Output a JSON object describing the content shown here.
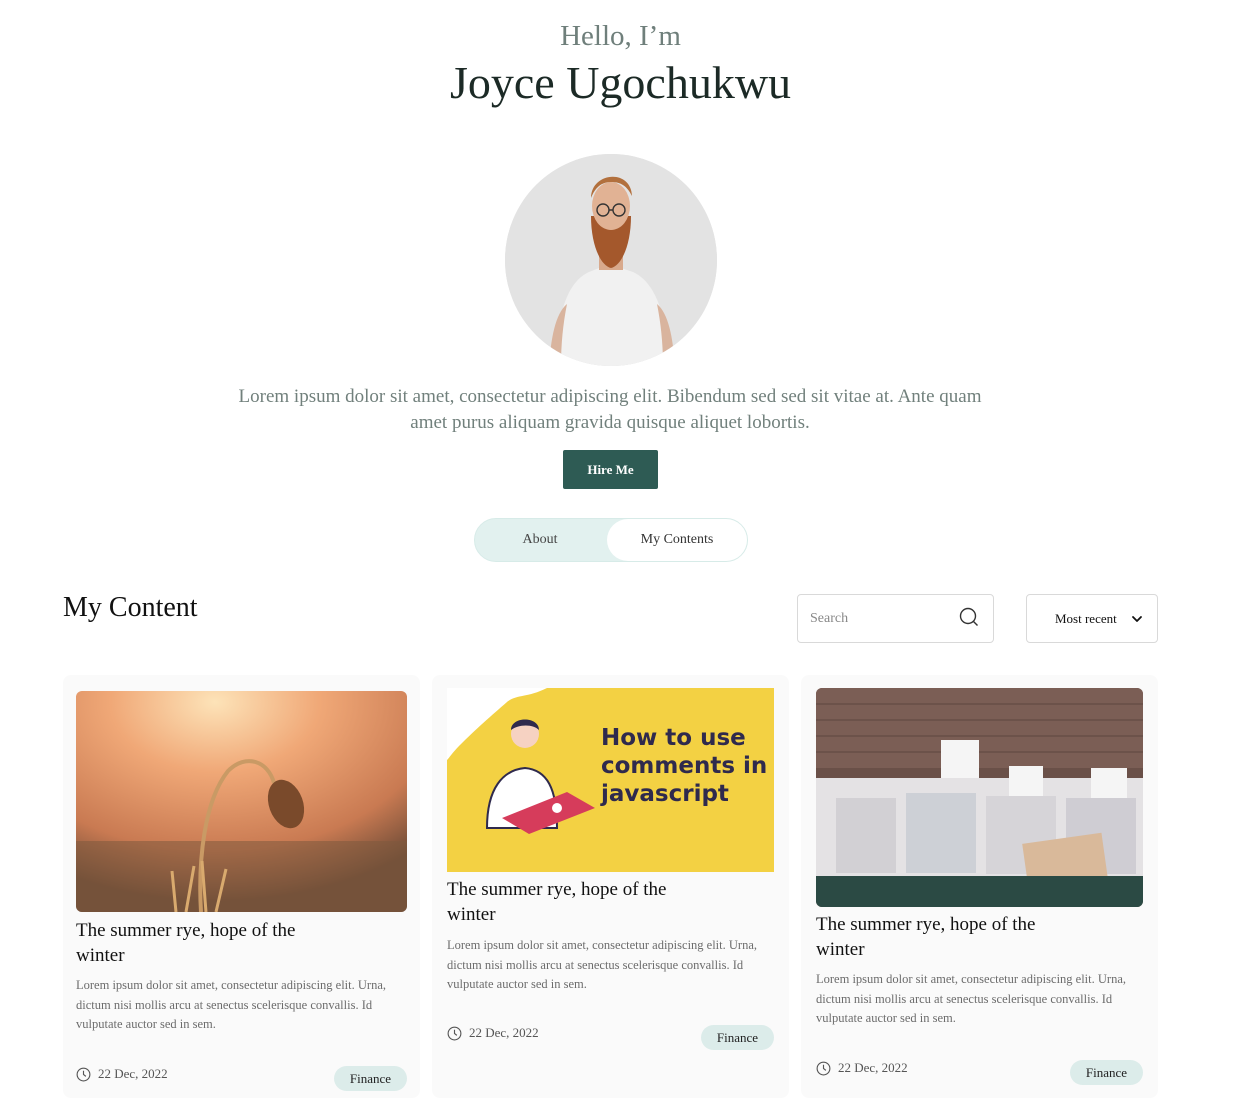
{
  "hero": {
    "greeting": "Hello, I’m",
    "name": "Joyce Ugochukwu",
    "bio": "Lorem ipsum dolor sit amet, consectetur adipiscing elit. Bibendum sed sed sit vitae at. Ante quam amet purus aliquam gravida quisque aliquet lobortis.",
    "hire_label": "Hire Me"
  },
  "tabs": [
    {
      "label": "About",
      "active": false
    },
    {
      "label": "My Contents",
      "active": true
    }
  ],
  "content": {
    "title": "My Content",
    "search_placeholder": "Search",
    "sort_value": "Most recent",
    "cards": [
      {
        "title": "The summer rye, hope of the winter",
        "text": "Lorem ipsum dolor sit amet, consectetur adipiscing elit. Urna, dictum nisi mollis arcu at senectus scelerisque convallis. Id vulputate auctor sed in sem.",
        "date": "22 Dec, 2022",
        "tag": "Finance"
      },
      {
        "title": "The summer rye, hope of the winter",
        "text": "Lorem ipsum dolor sit amet, consectetur adipiscing elit. Urna, dictum nisi mollis arcu at senectus scelerisque convallis. Id vulputate auctor sed in sem.",
        "date": "22 Dec, 2022",
        "tag": "Finance",
        "image_text": [
          "How to use",
          "comments in",
          "javascript"
        ]
      },
      {
        "title": "The summer rye, hope of the winter",
        "text": "Lorem ipsum dolor sit amet, consectetur adipiscing elit. Urna, dictum nisi mollis arcu at senectus scelerisque convallis. Id vulputate auctor sed in sem.",
        "date": "22 Dec, 2022",
        "tag": "Finance"
      }
    ]
  },
  "colors": {
    "accent": "#2e5b54",
    "tab_bg": "#e2f1ef",
    "badge_bg": "#dcecea",
    "muted_text": "#71807c"
  },
  "icons": [
    "search-icon",
    "chevron-down-icon",
    "clock-icon"
  ]
}
